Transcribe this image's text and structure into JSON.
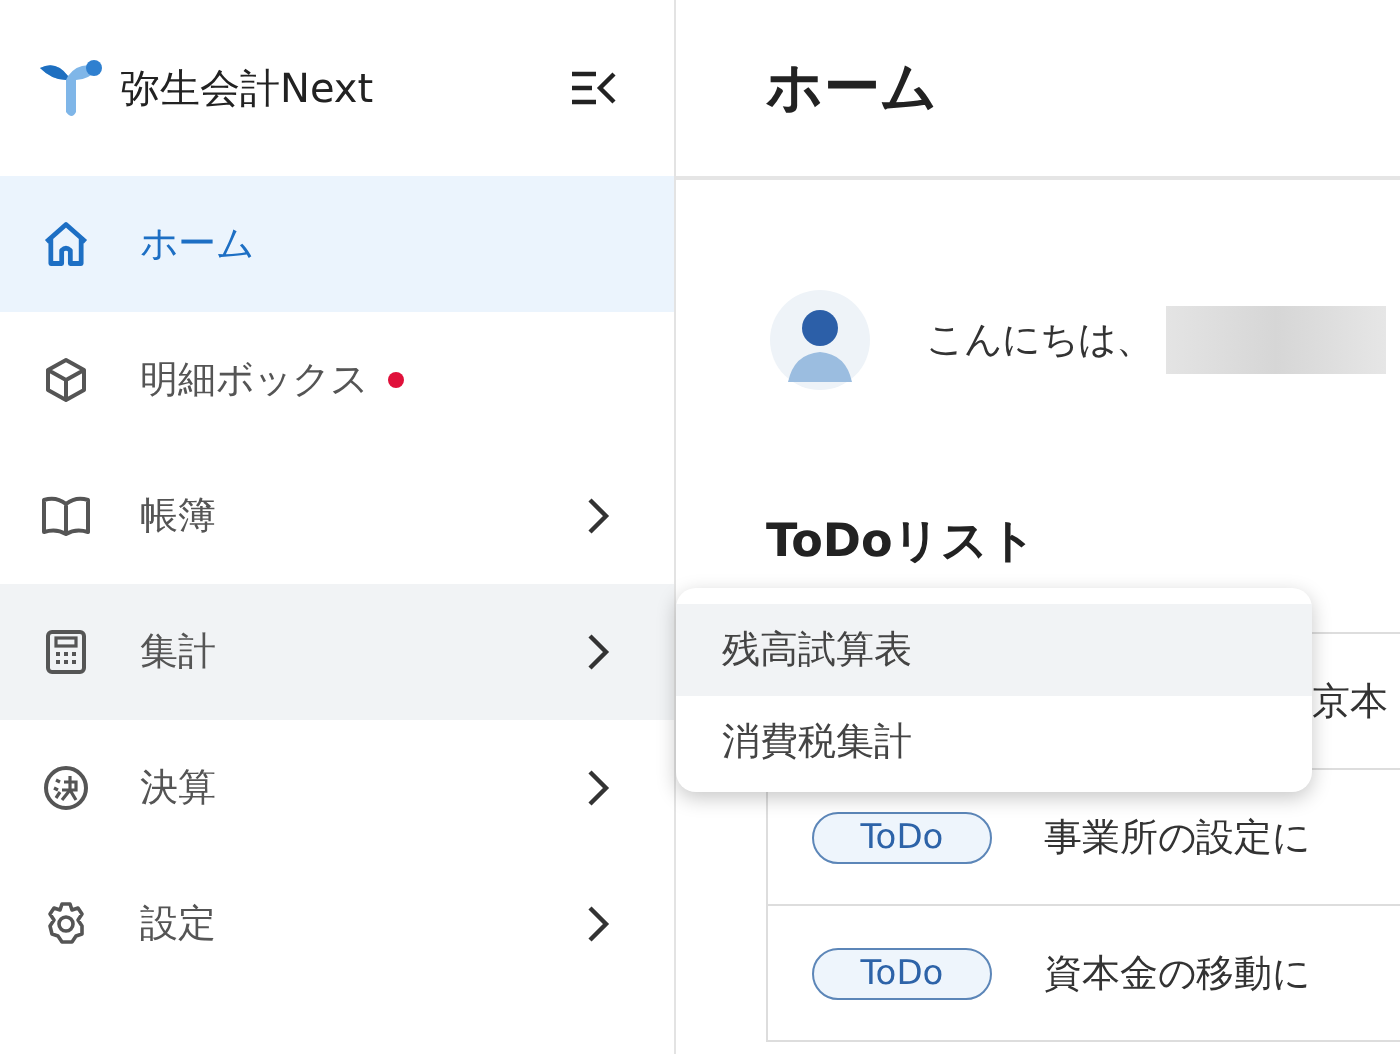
{
  "sidebar": {
    "brand": "弥生会計Next",
    "items": [
      {
        "label": "ホーム",
        "selected": true,
        "expanded": false,
        "has_submenu": false,
        "badge": false
      },
      {
        "label": "明細ボックス",
        "selected": false,
        "expanded": false,
        "has_submenu": false,
        "badge": true
      },
      {
        "label": "帳簿",
        "selected": false,
        "expanded": false,
        "has_submenu": true,
        "badge": false
      },
      {
        "label": "集計",
        "selected": false,
        "expanded": true,
        "has_submenu": true,
        "badge": false
      },
      {
        "label": "決算",
        "selected": false,
        "expanded": false,
        "has_submenu": true,
        "badge": false
      },
      {
        "label": "設定",
        "selected": false,
        "expanded": false,
        "has_submenu": true,
        "badge": false
      }
    ]
  },
  "submenu": {
    "items": [
      {
        "label": "残高試算表",
        "selected": true
      },
      {
        "label": "消費税集計",
        "selected": false
      }
    ]
  },
  "main": {
    "title": "ホーム",
    "greeting": "こんにちは、",
    "todo_title": "ToDoリスト",
    "todos": [
      {
        "text": "京本"
      },
      {
        "tag": "ToDo",
        "text": "事業所の設定に"
      },
      {
        "tag": "ToDo",
        "text": "資本金の移動に"
      }
    ]
  }
}
